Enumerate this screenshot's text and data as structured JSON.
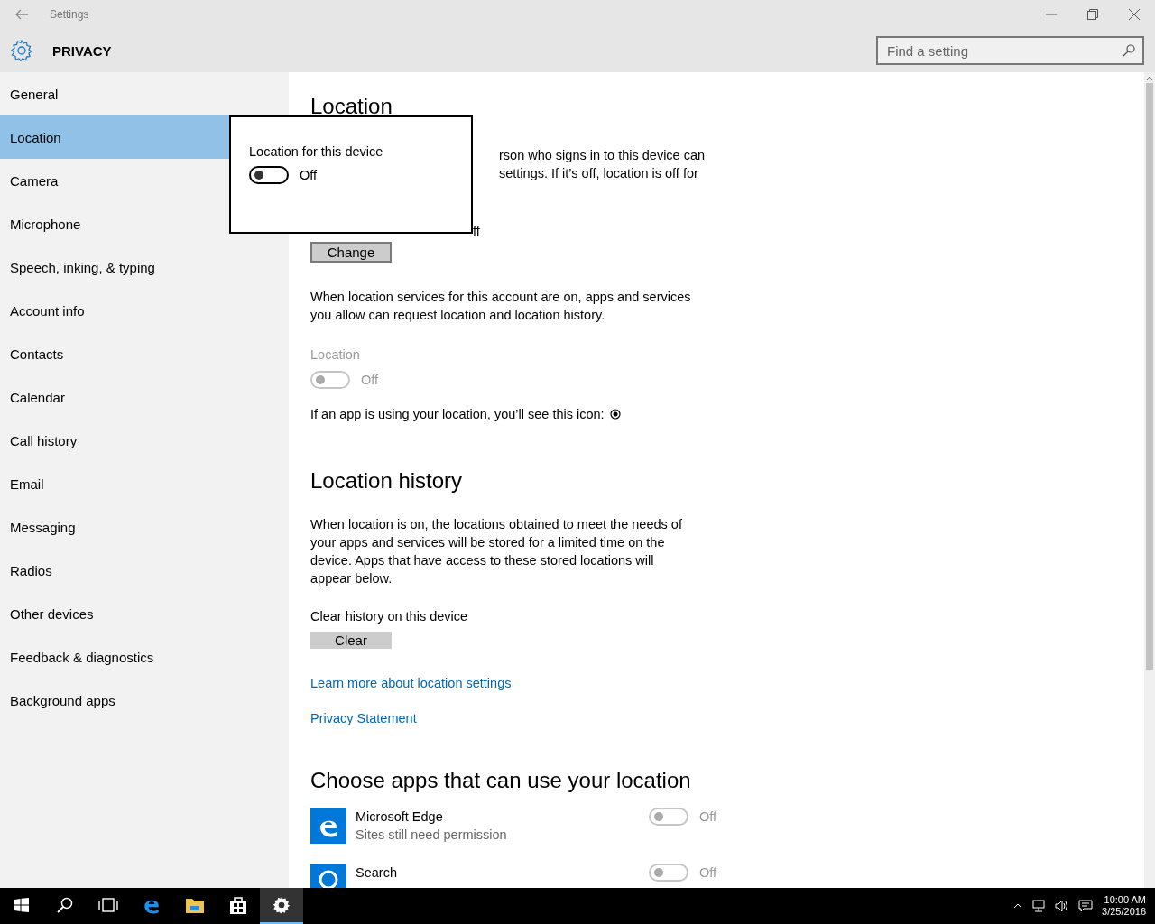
{
  "window": {
    "title": "Settings"
  },
  "header": {
    "title": "PRIVACY",
    "search_placeholder": "Find a setting"
  },
  "sidebar": {
    "items": [
      {
        "label": "General",
        "selected": false
      },
      {
        "label": "Location",
        "selected": true
      },
      {
        "label": "Camera",
        "selected": false
      },
      {
        "label": "Microphone",
        "selected": false
      },
      {
        "label": "Speech, inking, & typing",
        "selected": false
      },
      {
        "label": "Account info",
        "selected": false
      },
      {
        "label": "Contacts",
        "selected": false
      },
      {
        "label": "Calendar",
        "selected": false
      },
      {
        "label": "Call history",
        "selected": false
      },
      {
        "label": "Email",
        "selected": false
      },
      {
        "label": "Messaging",
        "selected": false
      },
      {
        "label": "Radios",
        "selected": false
      },
      {
        "label": "Other devices",
        "selected": false
      },
      {
        "label": "Feedback & diagnostics",
        "selected": false
      },
      {
        "label": "Background apps",
        "selected": false
      }
    ]
  },
  "popup": {
    "label": "Location for this device",
    "toggle": {
      "on": false,
      "disabled": false,
      "state_text": "Off"
    }
  },
  "location": {
    "heading": "Location",
    "fragments": [
      "rson who signs in to this device can",
      "settings. If it’s off, location is off for",
      "ff"
    ],
    "button": "Change",
    "paragraph": "When location services for this account are on, apps and services you allow can request location and location history.",
    "setting": {
      "label": "Location",
      "on": false,
      "disabled": true,
      "state_text": "Off"
    },
    "icon_note": "If an app is using your location, you’ll see this icon:"
  },
  "history": {
    "heading": "Location history",
    "paragraph": "When location is on, the locations obtained to meet the needs of your apps and services will be stored for a limited time on the device. Apps that have access to these stored locations will appear below.",
    "clear_label": "Clear history on this device",
    "button": "Clear"
  },
  "links": [
    "Learn more about location settings",
    "Privacy Statement"
  ],
  "apps": {
    "heading": "Choose apps that can use your location",
    "items": [
      {
        "kind": "edge",
        "name": "Microsoft Edge",
        "subtitle": "Sites still need permission",
        "on": false,
        "disabled": true,
        "state_text": "Off"
      },
      {
        "kind": "search",
        "name": "Search",
        "on": false,
        "disabled": true,
        "state_text": "Off"
      }
    ]
  },
  "taskbar": {
    "items": [
      {
        "kind": "start",
        "selected": false
      },
      {
        "kind": "search",
        "selected": false
      },
      {
        "kind": "taskview",
        "selected": false
      },
      {
        "kind": "edge",
        "selected": false
      },
      {
        "kind": "explorer",
        "selected": false
      },
      {
        "kind": "store",
        "selected": false
      },
      {
        "kind": "settings",
        "selected": true
      }
    ],
    "time": "10:00 AM",
    "date": "3/25/2016"
  }
}
